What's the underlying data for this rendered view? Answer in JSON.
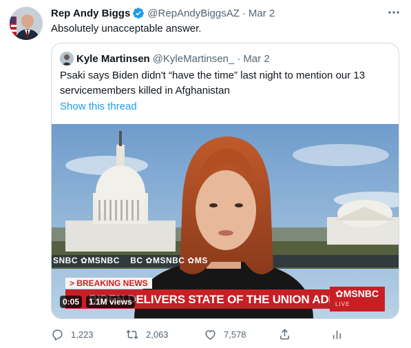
{
  "tweet": {
    "author_name": "Rep Andy Biggs",
    "author_handle": "@RepAndyBiggsAZ",
    "separator": "·",
    "date": "Mar 2",
    "text": "Absolutely unacceptable answer."
  },
  "quote": {
    "author_name": "Kyle Martinsen",
    "author_handle": "@KyleMartinsen_",
    "separator": "·",
    "date": "Mar 2",
    "text": "Psaki says Biden didn't “have the time” last night to mention our 13 servicemembers killed in Afghanistan",
    "show_thread_label": "Show this thread",
    "video": {
      "ticker_text": "SNBC ✿MSNBC    BC ✿MSNBC ✿MS",
      "breaking_label": "> BREAKING NEWS",
      "headline": "BIDEN DELIVERS STATE OF THE UNION ADDRESS",
      "network_logo": "✿MSNBC",
      "live_label": "LIVE",
      "time": "0:05",
      "views": "1.1M views"
    }
  },
  "actions": {
    "replies": "1,223",
    "retweets": "2,063",
    "likes": "7,578"
  },
  "colors": {
    "accent": "#1d9bf0",
    "secondary_text": "#536471",
    "border": "#cfd9de",
    "news_red": "#c81f25"
  },
  "icons": [
    "more-icon",
    "verified-badge-icon",
    "reply-icon",
    "retweet-icon",
    "like-icon",
    "share-icon",
    "analytics-icon"
  ]
}
